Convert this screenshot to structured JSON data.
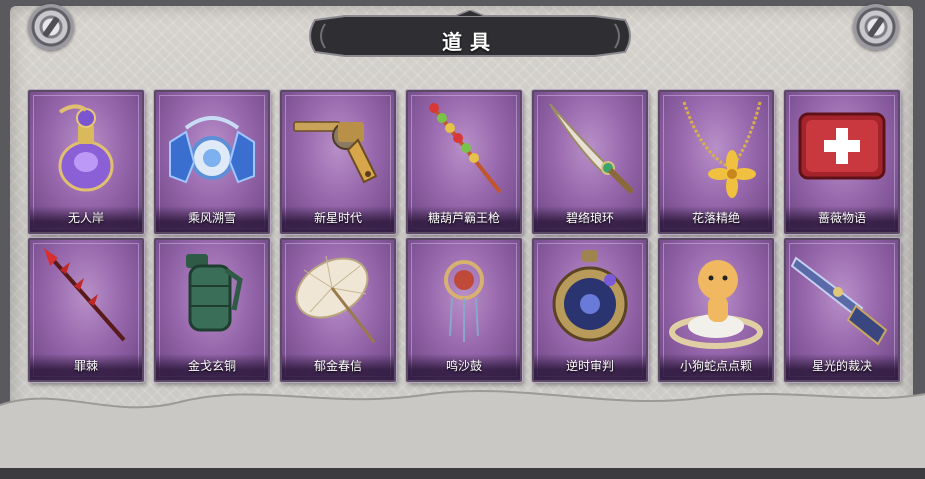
{
  "header": {
    "title": "道具"
  },
  "items": [
    {
      "label": "无人岸",
      "icon": "ornate-potion-icon"
    },
    {
      "label": "乘风溯雪",
      "icon": "blue-lanterns-icon"
    },
    {
      "label": "新星时代",
      "icon": "golden-revolver-icon"
    },
    {
      "label": "糖葫芦霸王枪",
      "icon": "candied-spear-icon"
    },
    {
      "label": "碧络琅环",
      "icon": "jade-blade-icon"
    },
    {
      "label": "花落精绝",
      "icon": "golden-flower-necklace-icon"
    },
    {
      "label": "蔷薇物语",
      "icon": "medkit-icon"
    },
    {
      "label": "罪棘",
      "icon": "thorn-spear-icon"
    },
    {
      "label": "金戈玄铜",
      "icon": "bronze-grenade-icon"
    },
    {
      "label": "郁金春信",
      "icon": "paper-umbrella-icon"
    },
    {
      "label": "鸣沙鼓",
      "icon": "dreamcatcher-drum-icon"
    },
    {
      "label": "逆时审判",
      "icon": "pocket-watch-icon"
    },
    {
      "label": "小狗蛇点点颗",
      "icon": "lucky-snake-icon"
    },
    {
      "label": "星光的裁决",
      "icon": "starlight-rifle-icon"
    }
  ],
  "colors": {
    "card_purple": "#9868ad",
    "card_border": "#5a4a64",
    "banner_dark": "#2f2f33"
  }
}
